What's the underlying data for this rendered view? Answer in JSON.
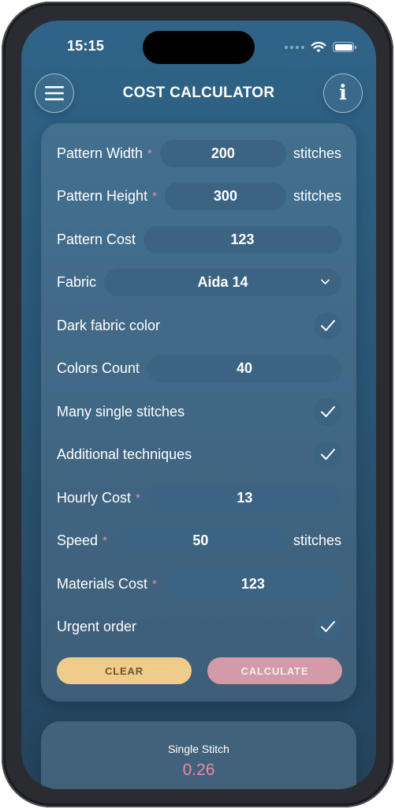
{
  "status_bar": {
    "time": "15:15"
  },
  "header": {
    "title": "COST CALCULATOR"
  },
  "form": {
    "pattern_width": {
      "label": "Pattern Width",
      "required": "*",
      "value": "200",
      "unit": "stitches"
    },
    "pattern_height": {
      "label": "Pattern Height",
      "required": "*",
      "value": "300",
      "unit": "stitches"
    },
    "pattern_cost": {
      "label": "Pattern Cost",
      "value": "123"
    },
    "fabric": {
      "label": "Fabric",
      "value": "Aida 14"
    },
    "dark_fabric": {
      "label": "Dark fabric color",
      "checked": true
    },
    "colors_count": {
      "label": "Colors Count",
      "value": "40"
    },
    "many_single": {
      "label": "Many single stitches",
      "checked": true
    },
    "additional": {
      "label": "Additional techniques",
      "checked": true
    },
    "hourly_cost": {
      "label": "Hourly Cost",
      "required": "*",
      "value": "13"
    },
    "speed": {
      "label": "Speed",
      "required": "*",
      "value": "50",
      "unit": "stitches"
    },
    "materials_cost": {
      "label": "Materials Cost",
      "required": "*",
      "value": "123"
    },
    "urgent": {
      "label": "Urgent order",
      "checked": true
    }
  },
  "actions": {
    "clear_label": "CLEAR",
    "calculate_label": "CALCULATE"
  },
  "result": {
    "label": "Single Stitch",
    "value": "0.26"
  },
  "colors": {
    "screen_bg": "#2f6488",
    "field_bg": "#3b6382",
    "required_accent": "#e98ba4",
    "clear_button": "#f0cc8a",
    "calculate_button": "#d39aa7"
  },
  "icons": {
    "menu": "hamburger-icon",
    "info": "info-icon",
    "dropdown": "chevron-down-icon",
    "check": "checkmark-icon"
  }
}
